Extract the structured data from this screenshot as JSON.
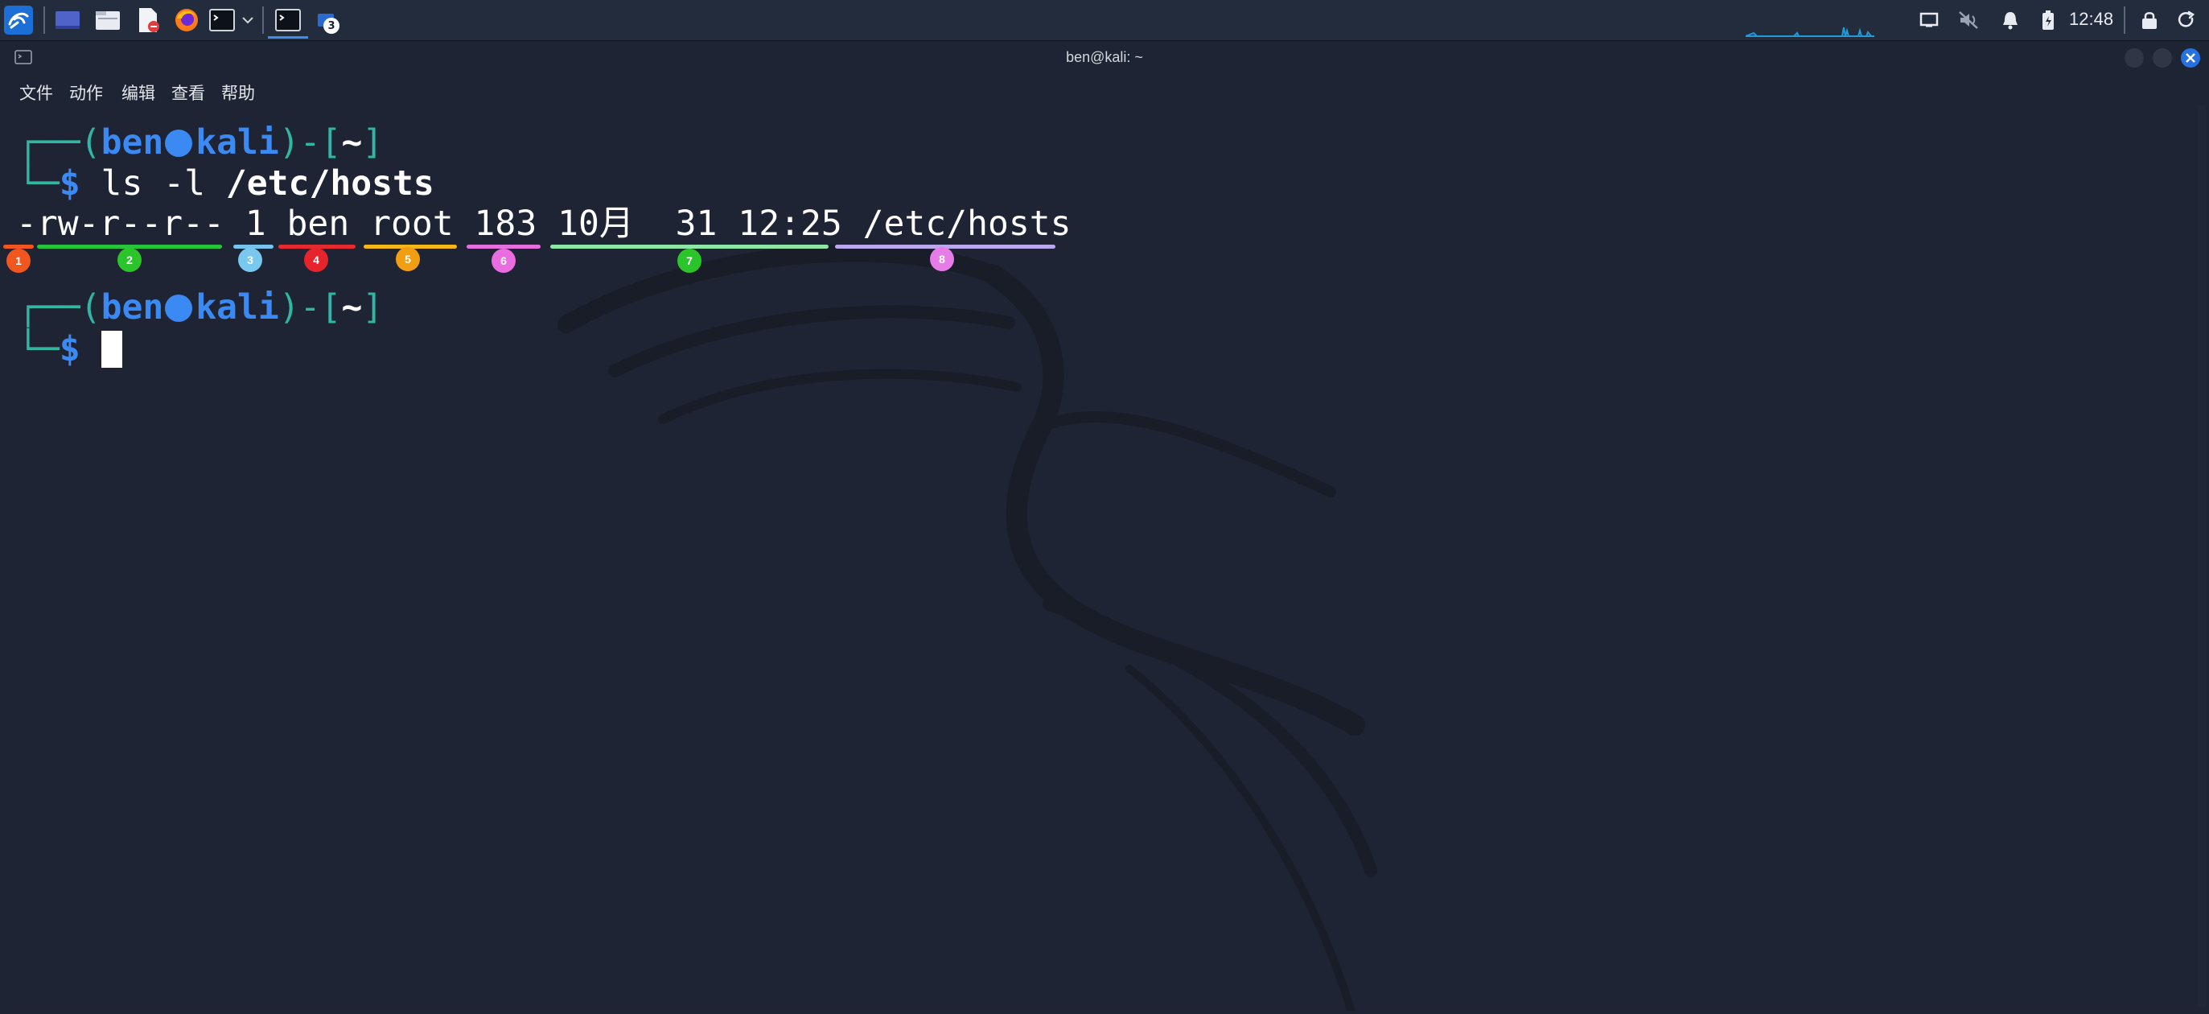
{
  "taskbar": {
    "icons": [
      "kali-menu-icon",
      "desktop-icon",
      "file-manager-icon",
      "text-editor-icon",
      "firefox-icon",
      "terminal-icon",
      "dropdown-icon",
      "terminal-window-icon",
      "windows-icon"
    ],
    "window_badge": "3",
    "clock": "12:48",
    "tray": [
      "display-icon",
      "mute-icon",
      "bell-icon",
      "battery-icon",
      "lock-icon",
      "power-icon"
    ]
  },
  "window": {
    "title": "ben@kali: ~"
  },
  "menubar": {
    "items": [
      "文件",
      "动作",
      "编辑",
      "查看",
      "帮助"
    ]
  },
  "terminal": {
    "prompt1": {
      "open": "┌──(",
      "user": "ben",
      "host": "kali",
      "mid": ")-[",
      "dir": "~",
      "close": "]"
    },
    "cmd_line": {
      "corner": "└─",
      "dollar": "$",
      "cmd": " ls -l ",
      "arg": "/etc/hosts"
    },
    "output": "-rw-r--r-- 1 ben root 183 10月  31 12:25 /etc/hosts",
    "prompt2": {
      "open": "┌──(",
      "user": "ben",
      "host": "kali",
      "mid": ")-[",
      "dir": "~",
      "close": "]"
    },
    "prompt2_cmd": {
      "corner": "└─",
      "dollar": "$"
    }
  },
  "annotations": [
    {
      "label": "1",
      "color": "#f0561f"
    },
    {
      "label": "2",
      "color": "#2bc42b"
    },
    {
      "label": "3",
      "color": "#79c8ef"
    },
    {
      "label": "4",
      "color": "#e5242c"
    },
    {
      "label": "5",
      "color": "#f29e12"
    },
    {
      "label": "6",
      "color": "#ea6de0"
    },
    {
      "label": "7",
      "color": "#2bc42b"
    },
    {
      "label": "8",
      "color": "#e67de6"
    }
  ],
  "colors": {
    "underline_1": "#f0561f",
    "underline_2": "#26c43a",
    "underline_3": "#76c3ee",
    "underline_4": "#e42a2f",
    "underline_5": "#f5b617",
    "underline_6": "#e56fdc",
    "underline_7": "#8ee6a6",
    "underline_8": "#bba8ec"
  }
}
